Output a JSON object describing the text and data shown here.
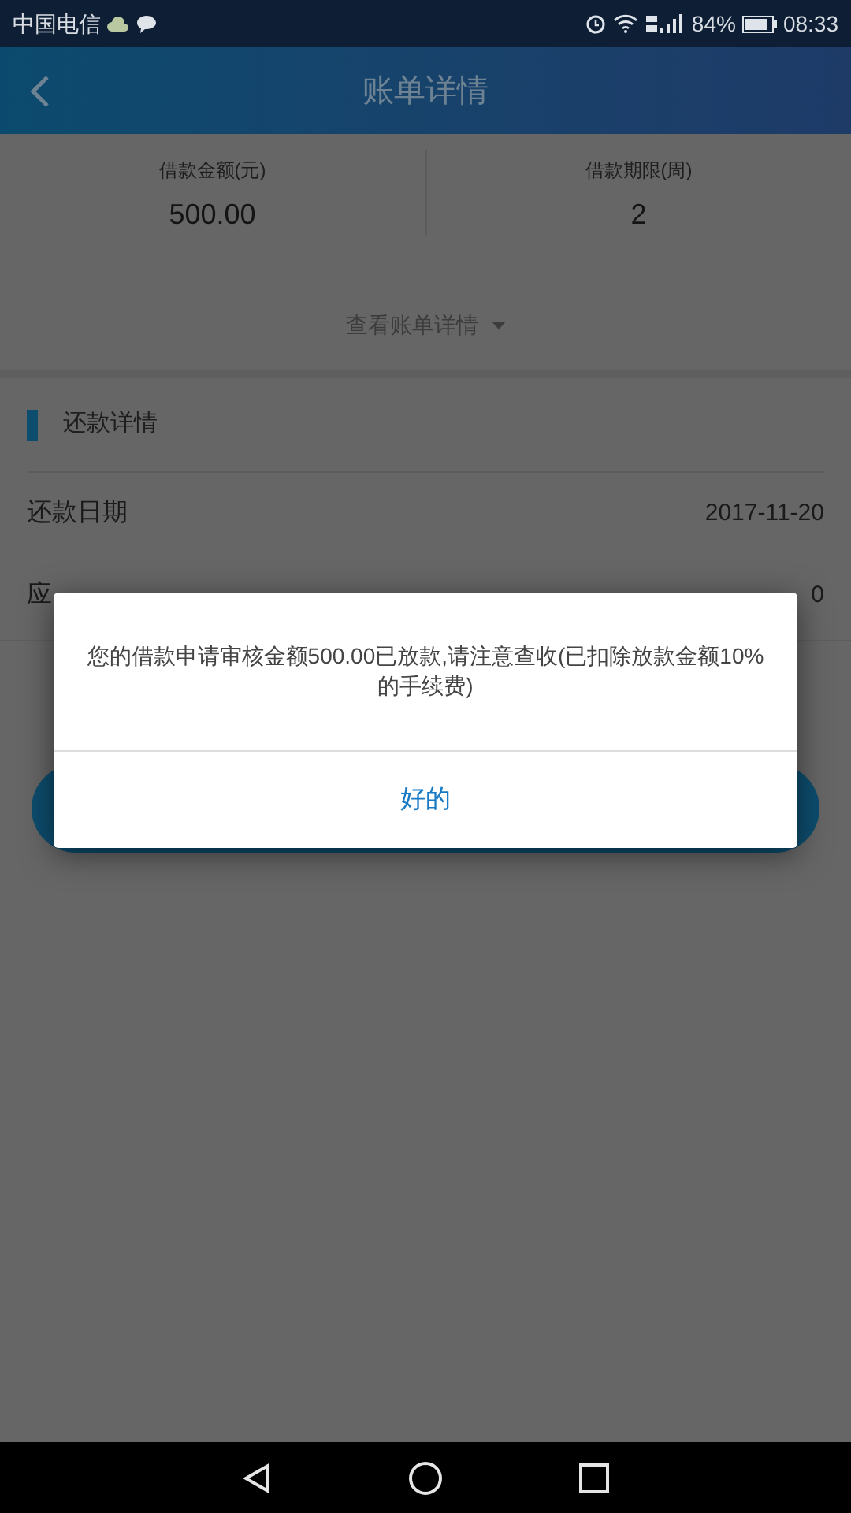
{
  "status_bar": {
    "carrier": "中国电信",
    "battery_percent": "84%",
    "time": "08:33"
  },
  "header": {
    "title": "账单详情"
  },
  "summary": [
    {
      "label": "借款金额(元)",
      "value": "500.00"
    },
    {
      "label": "借款期限(周)",
      "value": "2"
    }
  ],
  "details_toggle": {
    "label": "查看账单详情"
  },
  "section": {
    "title": "还款详情",
    "rows": [
      {
        "label": "还款日期",
        "value": "2017-11-20"
      },
      {
        "label": "应",
        "value": "0"
      }
    ]
  },
  "dialog": {
    "message": "您的借款申请审核金额500.00已放款,请注意查收(已扣除放款金额10%的手续费)",
    "button": "好的"
  }
}
